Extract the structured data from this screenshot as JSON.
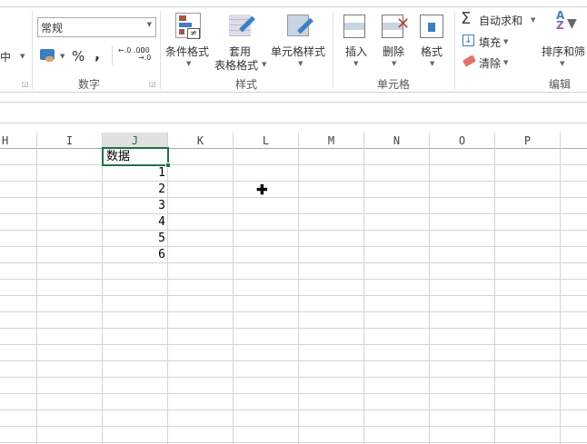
{
  "ribbon": {
    "alignment": {
      "merge_center_partial": "中"
    },
    "number": {
      "format_value": "常规",
      "group_label": "数字",
      "percent": "%",
      "comma": ",",
      "increase_decimal": "←.0 .00",
      "decrease_decimal": ".00 →.0"
    },
    "styles": {
      "conditional_format": "条件格式",
      "format_table_line1": "套用",
      "format_table_line2": "表格格式",
      "cell_styles": "单元格样式",
      "group_label": "样式"
    },
    "cells": {
      "insert": "插入",
      "delete": "删除",
      "format": "格式",
      "group_label": "单元格"
    },
    "editing": {
      "autosum": "自动求和",
      "fill": "填充",
      "clear": "清除",
      "sort_filter": "排序和筛",
      "group_label": "编辑"
    }
  },
  "grid": {
    "columns": [
      "H",
      "I",
      "J",
      "K",
      "L",
      "M",
      "N",
      "O",
      "P"
    ],
    "active_column": "J",
    "cells": {
      "header": "数据",
      "values": [
        "1",
        "2",
        "3",
        "4",
        "5",
        "6"
      ]
    },
    "accent": "#217346"
  }
}
